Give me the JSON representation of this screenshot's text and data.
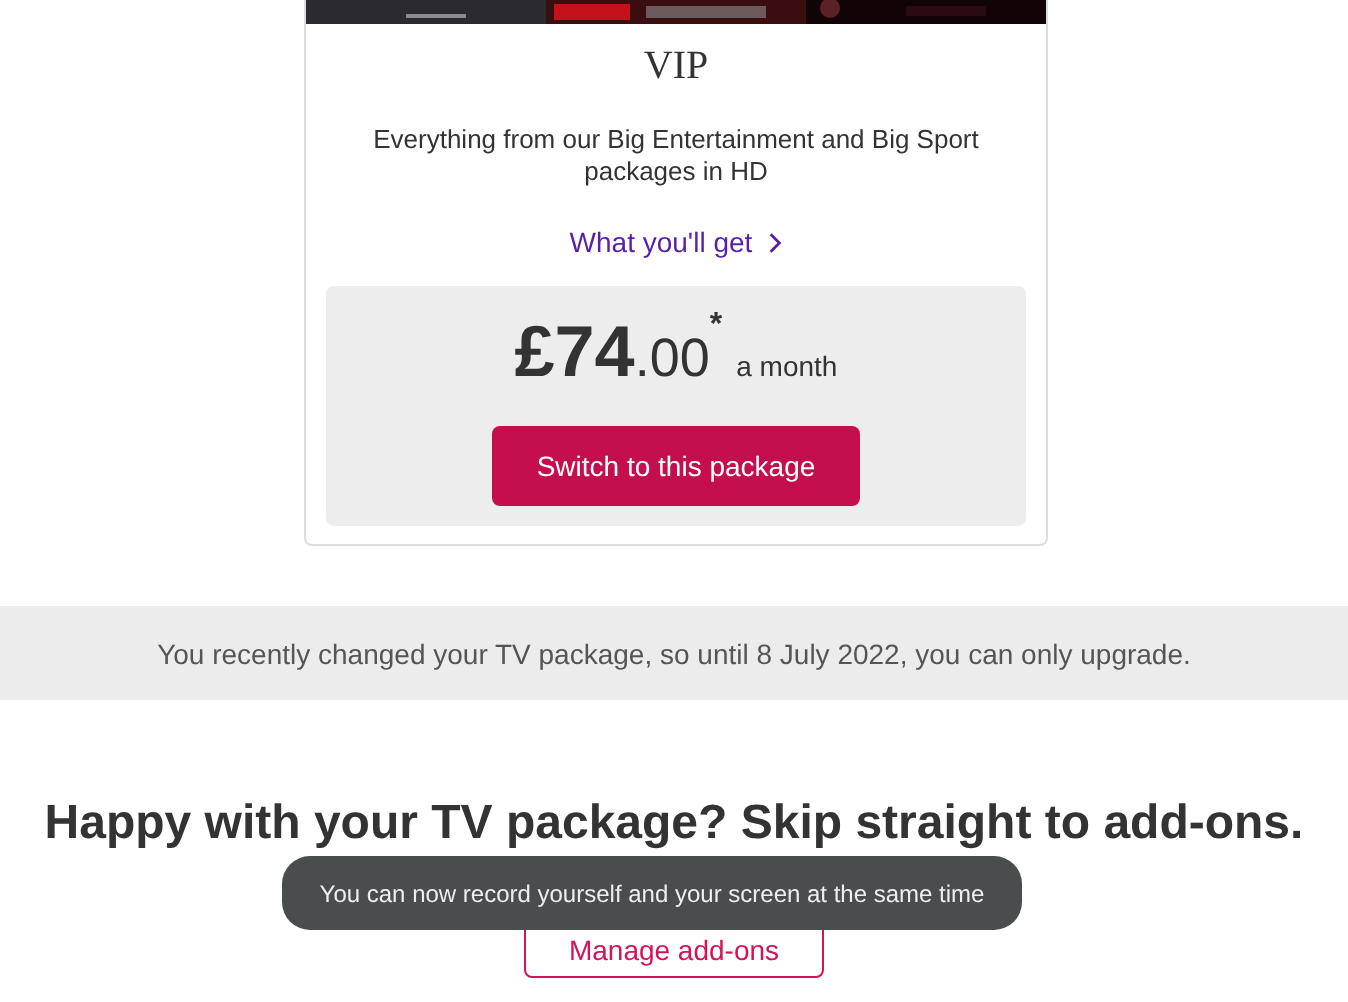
{
  "package_card": {
    "title": "VIP",
    "description": "Everything from our Big Entertainment and Big Sport packages in HD",
    "link": "What you'll get",
    "price": {
      "pounds": "£74",
      "pence": ".00",
      "footnote": "*",
      "period": "a month"
    },
    "button": "Switch to this package"
  },
  "notice": "You recently changed your TV package, so until 8 July 2022, you can only upgrade.",
  "addons": {
    "heading": "Happy with your TV package? Skip straight to add-ons.",
    "button": "Manage add-ons"
  },
  "toast": "You can now record yourself and your screen at the same time"
}
